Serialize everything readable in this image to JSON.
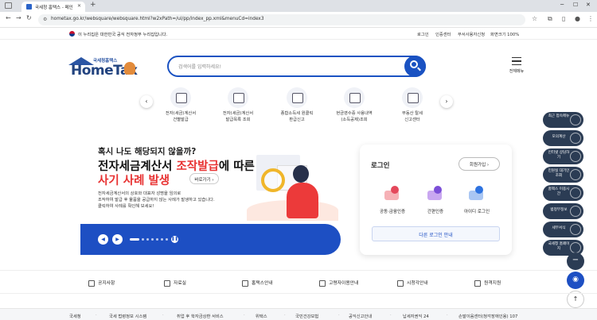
{
  "browser": {
    "tab_title": "국세청 홈택스 - 메인",
    "url": "hometax.go.kr/websquare/websquare.html?w2xPath=/ui/pp/index_pp.xml&menuCd=index3"
  },
  "gov_banner": {
    "message": "이 누리집은 대한민국 공식 전자정부 누리집입니다.",
    "links": [
      "로그인",
      "인증센터",
      "부서사용자신청",
      "화면크기 100%"
    ]
  },
  "header": {
    "logo_small": "국세청홈택스",
    "logo_big": "HomeTax",
    "search_placeholder": "검색어를 입력하세요!",
    "menu_label": "전체메뉴"
  },
  "quick_menu": [
    {
      "line1": "전자(세금)계산서",
      "line2": "건별발급",
      "icon": "invoice-icon"
    },
    {
      "line1": "전자(세금)계산서",
      "line2": "발급목록 조회",
      "icon": "invoice-list-icon"
    },
    {
      "line1": "종합소득세 원클릭",
      "line2": "환급신고",
      "icon": "refund-icon"
    },
    {
      "line1": "현금영수증 사용내역",
      "line2": "(소득공제)조회",
      "icon": "receipt-icon"
    },
    {
      "line1": "부동산 탈세",
      "line2": "신고센터",
      "icon": "realestate-icon"
    }
  ],
  "hero": {
    "line1": "혹시 나도  해당되지 않을까?",
    "line2_a": "전자세금계산서 ",
    "line2_b": "조작발급",
    "line2_c": "에 따른",
    "line3": "사기 사례 발생",
    "more_label": "바로가기",
    "desc1": "전자세금계산서의 상호와 대표자 성명을 임의로",
    "desc2": "조작하여 발급 후 물품을 공급하지 않는 사례가 발생하고 있습니다.",
    "desc3": "클릭하여 사례를 확인해 보세요!"
  },
  "login": {
    "title": "로그인",
    "join_label": "회원가입",
    "options": [
      {
        "label": "공동·금융인증",
        "icon": "certificate-icon"
      },
      {
        "label": "간편인증",
        "icon": "simple-auth-icon"
      },
      {
        "label": "아이디 로그인",
        "icon": "id-login-icon"
      }
    ],
    "other_label": "다른 로그인 안내"
  },
  "sidebar": [
    {
      "label": "최근 접속메뉴",
      "icon": "clock-icon"
    },
    {
      "label": "모의계산",
      "icon": "calculator-icon"
    },
    {
      "label": "인터넷 상담하기",
      "icon": "chat-icon"
    },
    {
      "label": "민원실 대기인 조회",
      "icon": "people-icon"
    },
    {
      "label": "홈택스 이용시간",
      "icon": "time-icon"
    },
    {
      "label": "범정부정보",
      "icon": "info-icon"
    },
    {
      "label": "세무서식",
      "icon": "form-icon"
    },
    {
      "label": "국세청 홈페이지",
      "icon": "home-icon"
    }
  ],
  "bottom_links": [
    "공지사항",
    "자료실",
    "홈택스안내",
    "고령자이용안내",
    "시청각안내",
    "원격지원"
  ],
  "footer_links": [
    "국세청",
    "국세 법령정보 시스템",
    "취업 후 학자금상환 서비스",
    "위택스",
    "국민건강보험",
    "공익신고안내",
    "납세자권익 24",
    "손말이음센터(청각장애인용) 107"
  ],
  "colors": {
    "brand_blue": "#1d4fc3",
    "alert_red": "#e83232",
    "sidebar_dark": "#2b3c54"
  }
}
